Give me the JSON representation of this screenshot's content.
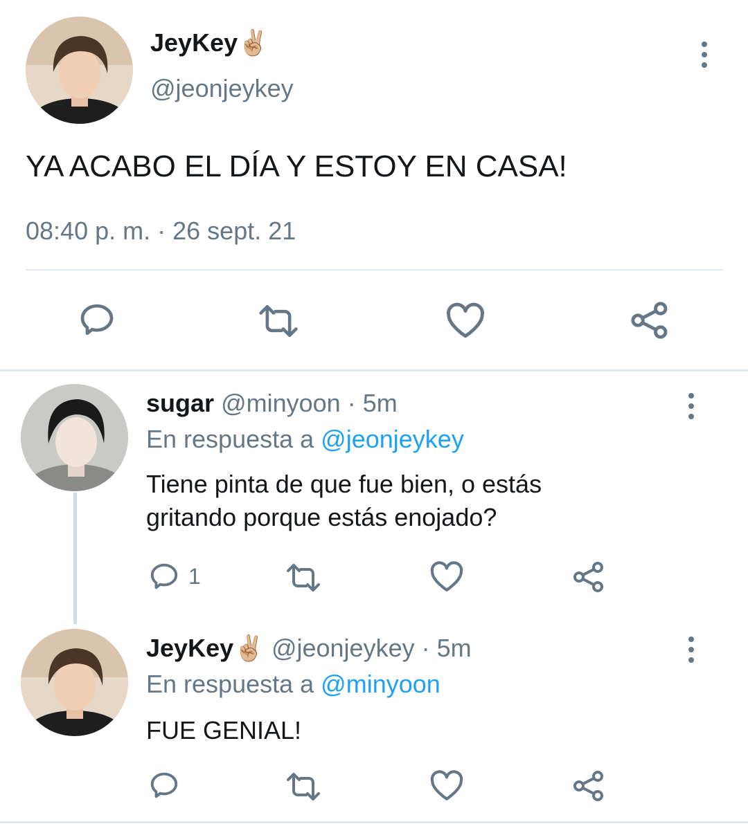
{
  "main_tweet": {
    "display_name": "JeyKey",
    "emoji": "✌🏼",
    "handle": "@jeonjeykey",
    "text": "YA ACABO EL DÍA Y ESTOY EN CASA!",
    "time": "08:40 p. m.",
    "separator": "·",
    "date": "26 sept. 21"
  },
  "replies": [
    {
      "display_name": "sugar",
      "handle": "@minyoon",
      "separator": "·",
      "age": "5m",
      "reply_prefix": "En respuesta a",
      "reply_to": "@jeonjeykey",
      "text_line1": "Tiene pinta de que fue bien, o estás",
      "text_line2": "gritando porque estás enojado?",
      "reply_count": "1"
    },
    {
      "display_name": "JeyKey",
      "emoji": "✌🏼",
      "handle": "@jeonjeykey",
      "separator": "·",
      "age": "5m",
      "reply_prefix": "En respuesta a",
      "reply_to": "@minyoon",
      "text": "FUE GENIAL!"
    }
  ],
  "colors": {
    "text": "#14171a",
    "muted": "#657786",
    "link": "#1da1f2",
    "divider": "#e1e8ed"
  },
  "icons": [
    "reply-icon",
    "retweet-icon",
    "like-icon",
    "share-icon",
    "more-options-icon"
  ]
}
